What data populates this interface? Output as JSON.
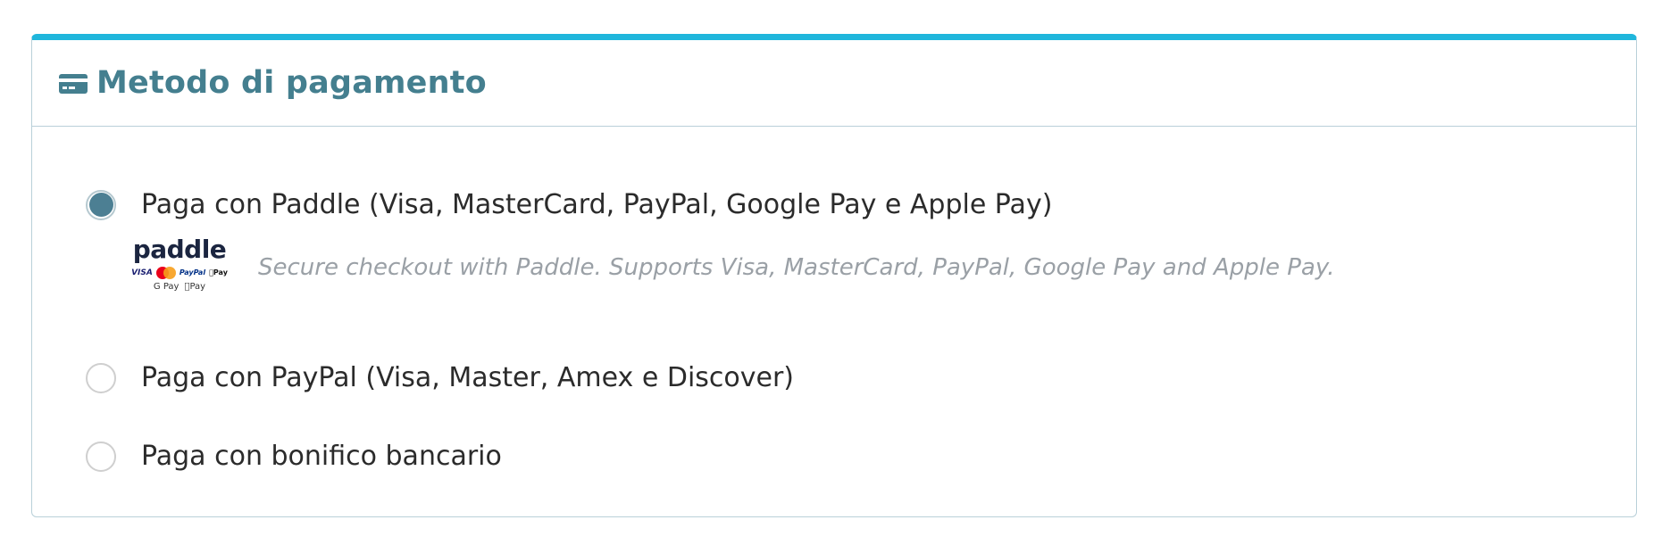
{
  "panel": {
    "title": "Metodo di pagamento",
    "icon": "credit-card-icon",
    "accent_color": "#1fb6dc",
    "title_color": "#447f8f"
  },
  "options": [
    {
      "label": "Paga con Paddle (Visa, MasterCard, PayPal, Google Pay e Apple Pay)",
      "selected": true
    },
    {
      "label": "Paga con PayPal (Visa, Master, Amex e Discover)",
      "selected": false
    },
    {
      "label": "Paga con bonifico bancario",
      "selected": false
    }
  ],
  "paddle": {
    "logo_text": "paddle",
    "brands": {
      "visa": "VISA",
      "paypal": "PayPal",
      "apple_pay_top": "Pay",
      "google_pay": "G Pay",
      "apple_pay": "Pay"
    },
    "description": "Secure checkout with Paddle. Supports Visa, MasterCard, PayPal, Google Pay and Apple Pay."
  }
}
